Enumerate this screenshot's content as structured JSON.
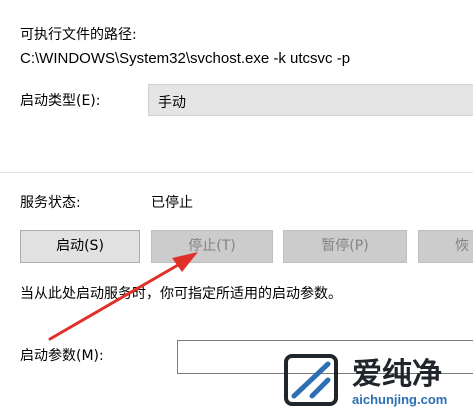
{
  "path": {
    "label": "可执行文件的路径:",
    "value": "C:\\WINDOWS\\System32\\svchost.exe -k utcsvc -p"
  },
  "startup_type": {
    "label": "启动类型(E):",
    "value": "手动"
  },
  "service_status": {
    "label": "服务状态:",
    "value": "已停止"
  },
  "buttons": {
    "start": "启动(S)",
    "stop": "停止(T)",
    "pause": "暂停(P)",
    "resume": "恢"
  },
  "hint": "当从此处启动服务时，你可指定所适用的启动参数。",
  "start_params": {
    "label": "启动参数(M):",
    "value": ""
  },
  "watermark": {
    "brand": "爱纯净",
    "url": "aichunjing.com"
  },
  "colors": {
    "arrow": "#e0302a",
    "select_bg": "#e5e5e5",
    "disabled_button_bg": "#cccccc"
  }
}
